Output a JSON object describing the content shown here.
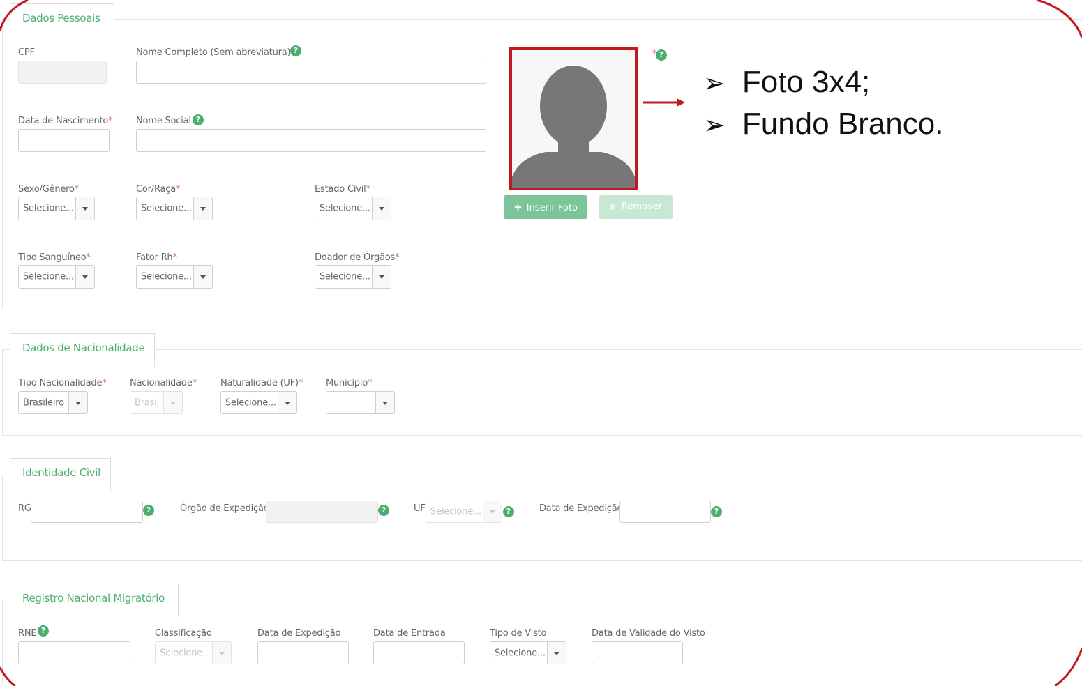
{
  "dados_pessoais": {
    "legend": "Dados Pessoais",
    "cpf_label": "CPF",
    "nome_completo_label": "Nome Completo (Sem abreviatura)",
    "data_nascimento_label": "Data de Nascimento",
    "nome_social_label": "Nome Social",
    "sexo_label": "Sexo/Gênero",
    "cor_label": "Cor/Raça",
    "estado_civil_label": "Estado Civil",
    "tipo_sanguineo_label": "Tipo Sanguíneo",
    "fator_rh_label": "Fator Rh",
    "doador_label": "Doador de Órgãos",
    "select_placeholder": "Selecione...",
    "inserir_foto": "Inserir Foto",
    "remover": "Remover"
  },
  "nacionalidade": {
    "legend": "Dados de Nacionalidade",
    "tipo_label": "Tipo Nacionalidade",
    "tipo_value": "Brasileiro",
    "nacionalidade_label": "Nacionalidade",
    "nacionalidade_value": "Brasil",
    "naturalidade_label": "Naturalidade (UF)",
    "naturalidade_value": "Selecione...",
    "municipio_label": "Município"
  },
  "identidade": {
    "legend": "Identidade Civil",
    "rg_label": "RG",
    "orgao_label": "Órgão de Expedição",
    "uf_label": "UF",
    "uf_value": "Selecione...",
    "data_label": "Data de Expedição"
  },
  "rnm": {
    "legend": "Registro Nacional Migratório",
    "rne_label": "RNE",
    "classificacao_label": "Classificação",
    "classificacao_value": "Selecione...",
    "data_expedicao_label": "Data de Expedição",
    "data_entrada_label": "Data de Entrada",
    "tipo_visto_label": "Tipo de Visto",
    "tipo_visto_value": "Selecione...",
    "validade_label": "Data de Validade do Visto"
  },
  "annotation": {
    "line1": "Foto 3x4;",
    "line2": "Fundo Branco."
  },
  "colors": {
    "accent_green": "#4cae6e",
    "highlight_red": "#c0191e"
  },
  "icons": {
    "help": "?",
    "plus": "+",
    "bullet": "➢"
  }
}
